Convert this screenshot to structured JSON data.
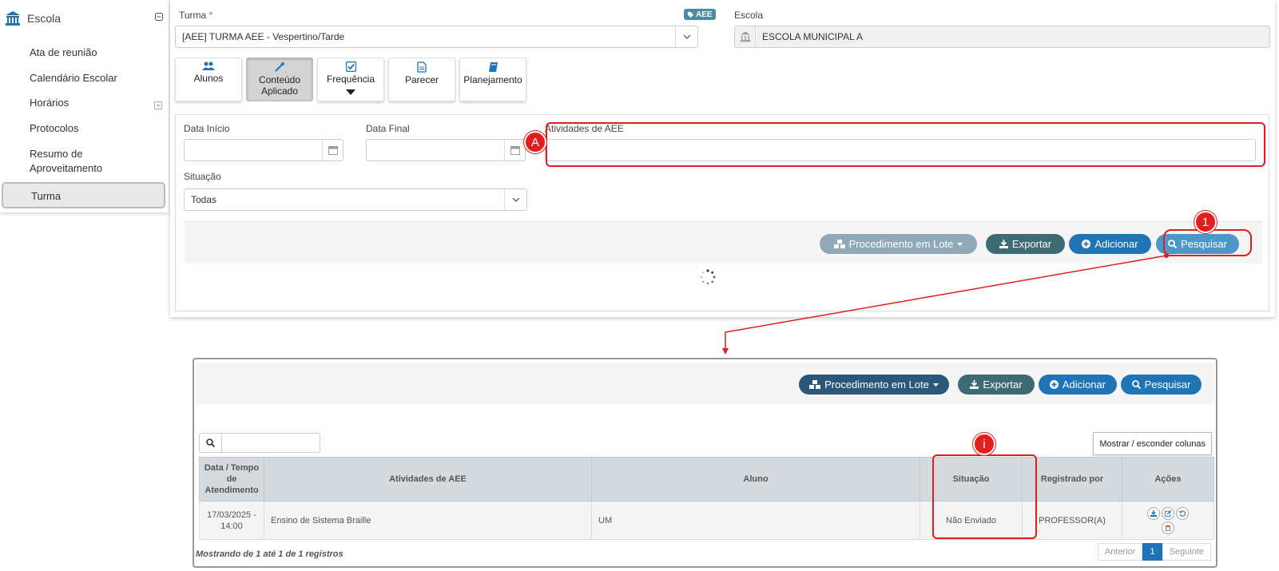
{
  "sidebar": {
    "title": "Escola",
    "items": [
      {
        "label": "Ata de reunião"
      },
      {
        "label": "Calendário Escolar"
      },
      {
        "label": "Horários"
      },
      {
        "label": "Protocolos"
      },
      {
        "label": "Resumo de Aproveitamento"
      },
      {
        "label": "Turma"
      }
    ]
  },
  "form": {
    "turma_label": "Turma",
    "required_mark": "*",
    "aee_badge": "AEE",
    "turma_value": "[AEE]  TURMA AEE - Vespertino/Tarde",
    "escola_label": "Escola",
    "escola_value": "ESCOLA MUNICIPAL A"
  },
  "tabs": [
    {
      "label": "Alunos"
    },
    {
      "label": "Conteúdo Aplicado"
    },
    {
      "label": "Frequência"
    },
    {
      "label": "Parecer"
    },
    {
      "label": "Planejamento"
    }
  ],
  "filters": {
    "data_inicio_label": "Data Início",
    "data_final_label": "Data Final",
    "atividades_label": "Atividades de AEE",
    "situacao_label": "Situação",
    "situacao_value": "Todas"
  },
  "actions": {
    "lote": "Procedimento em Lote",
    "exportar": "Exportar",
    "adicionar": "Adicionar",
    "pesquisar": "Pesquisar"
  },
  "markers": {
    "a": "A",
    "one": "1",
    "info": "i"
  },
  "results": {
    "columns_button": "Mostrar / esconder colunas",
    "headers": [
      "Data / Tempo de Atendimento",
      "Atividades de AEE",
      "Aluno",
      "Situação",
      "Registrado por",
      "Ações"
    ],
    "rows": [
      {
        "data": "17/03/2025 - 14:00",
        "atividade": "Ensino de Sistema Braille",
        "aluno": "UM",
        "situacao": "Não Enviado",
        "registrado": "PROFESSOR(A)"
      }
    ],
    "footer": "Mostrando de 1 até 1 de 1 registros",
    "pager": {
      "prev": "Anterior",
      "current": "1",
      "next": "Seguinte"
    }
  },
  "colors": {
    "accent": "#1f74b6",
    "annotation": "#e21d1d",
    "badge": "#4a8ba3"
  }
}
